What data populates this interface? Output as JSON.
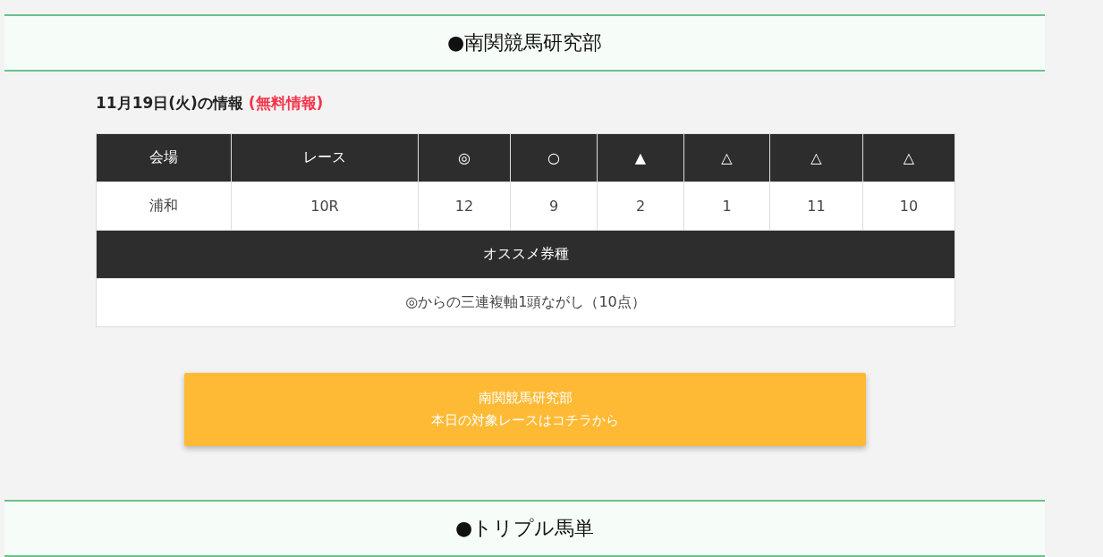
{
  "sections": [
    {
      "heading": "●南関競馬研究部"
    },
    {
      "heading": "●トリプル馬単"
    }
  ],
  "info": {
    "date": "11月19日(火)の情報",
    "tag": "(無料情報)"
  },
  "table": {
    "columns": [
      "会場",
      "レース",
      "◎",
      "○",
      "▲",
      "△",
      "△",
      "△"
    ],
    "row": [
      "浦和",
      "10R",
      "12",
      "9",
      "2",
      "1",
      "11",
      "10"
    ],
    "recommend_heading": "オススメ券種",
    "recommend": "◎からの三連複軸1頭ながし（10点）"
  },
  "button": {
    "lines": [
      "南関競馬研究部",
      "本日の対象レースはコチラから"
    ]
  }
}
